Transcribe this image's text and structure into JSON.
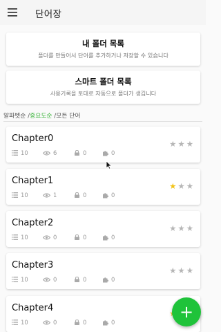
{
  "app_title": "단어장",
  "folders": [
    {
      "title": "내 폴더 목록",
      "subtitle": "폴더를 만들어서 단어를 추가하거나 저장할 수 있습니다"
    },
    {
      "title": "스마트 폴더 목록",
      "subtitle": "사용기록을 토대로 자동으로 폴더가 생깁니다"
    }
  ],
  "sort": {
    "option_1": "알파벳순",
    "separator_1": " /",
    "option_2": "중요도순",
    "separator_2": " /",
    "option_3": "모든 단어"
  },
  "chapters": [
    {
      "name": "Chapter0",
      "words": "10",
      "views": "6",
      "locked": "0",
      "puzzles": "0",
      "rating": 0
    },
    {
      "name": "Chapter1",
      "words": "10",
      "views": "1",
      "locked": "0",
      "puzzles": "0",
      "rating": 1
    },
    {
      "name": "Chapter2",
      "words": "10",
      "views": "0",
      "locked": "0",
      "puzzles": "0",
      "rating": 0
    },
    {
      "name": "Chapter3",
      "words": "10",
      "views": "0",
      "locked": "0",
      "puzzles": "0",
      "rating": 0
    },
    {
      "name": "Chapter4",
      "words": "10",
      "views": "0",
      "locked": "0",
      "puzzles": "0",
      "rating": 1
    }
  ],
  "fab_label": "+",
  "colors": {
    "accent": "#1fc33a",
    "active_sort": "#3db53d",
    "star_on": "#f2c318",
    "star_off": "#b6b6b6"
  }
}
